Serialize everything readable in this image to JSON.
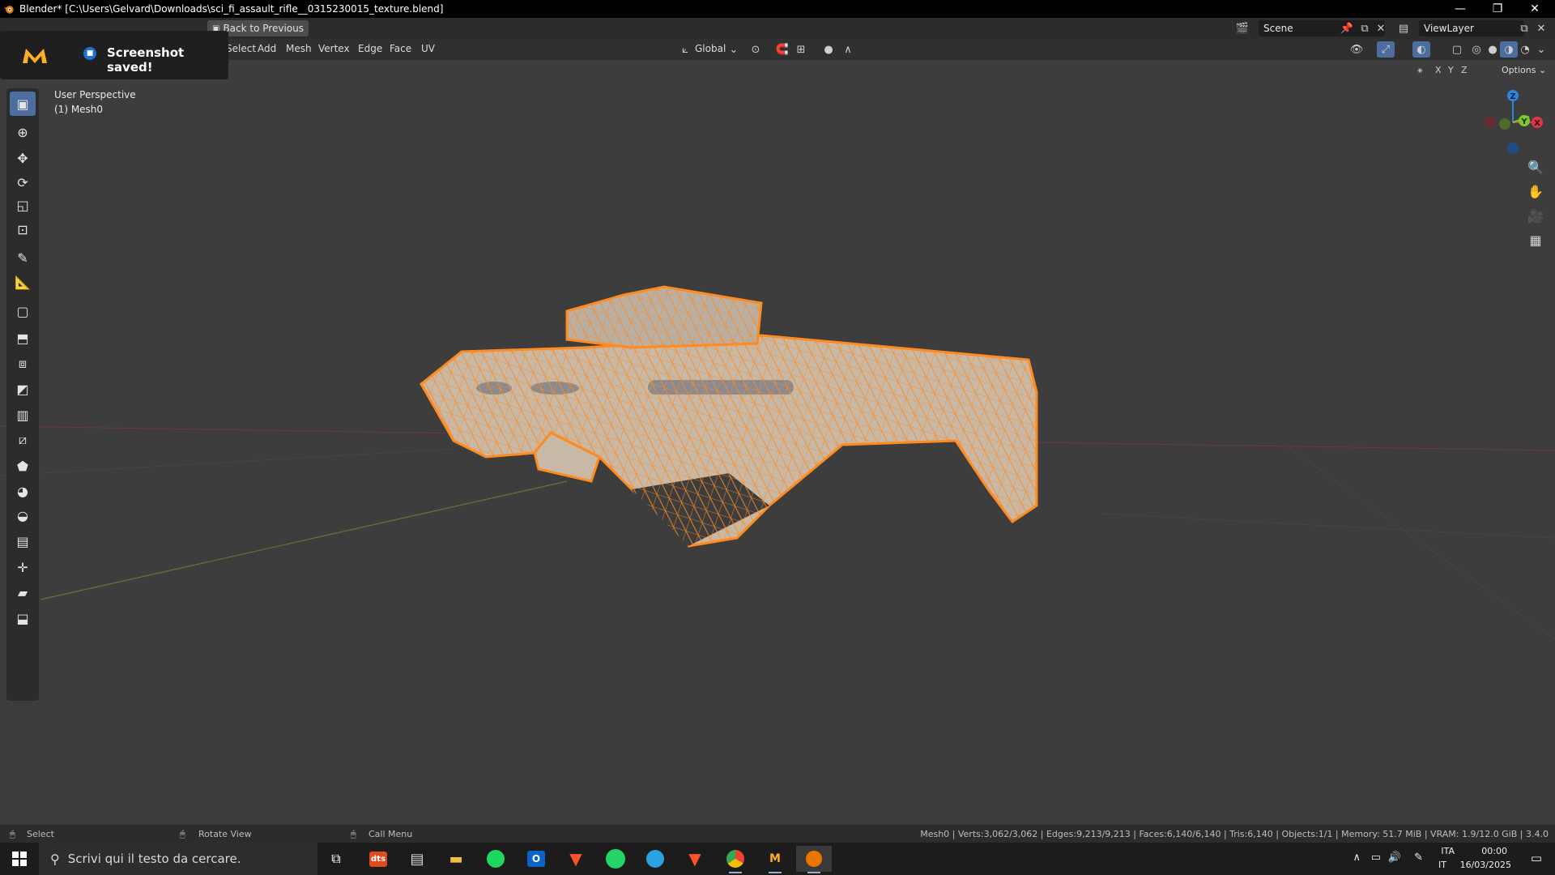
{
  "window": {
    "title": "Blender* [C:\\Users\\Gelvard\\Downloads\\sci_fi_assault_rifle__0315230015_texture.blend]",
    "minimize": "—",
    "restore": "❐",
    "close": "✕"
  },
  "topbar": {
    "back_button": "Back to Previous",
    "scene_label": "Scene",
    "viewlayer_label": "ViewLayer"
  },
  "header": {
    "menus": [
      "Select",
      "Add",
      "Mesh",
      "Vertex",
      "Edge",
      "Face",
      "UV"
    ],
    "transform_orientation": "Global",
    "options_label": "Options",
    "axes": [
      "X",
      "Y",
      "Z"
    ]
  },
  "toast": {
    "message": "Screenshot saved!"
  },
  "viewport": {
    "view_name": "User Perspective",
    "object_name": "(1) Mesh0"
  },
  "gizmo": {
    "z_label": "Z",
    "y_label": "Y",
    "x_label": "X",
    "colors": {
      "x": "#e0364d",
      "y": "#7ec82f",
      "z": "#2f84e0"
    }
  },
  "toolbar": {
    "tools": [
      "select-box-tool",
      "cursor-tool",
      "move-tool",
      "rotate-tool",
      "scale-tool",
      "transform-tool",
      "annotate-tool",
      "measure-tool",
      "add-cube-tool",
      "extrude-tool",
      "inset-tool",
      "bevel-tool",
      "loop-cut-tool",
      "knife-tool",
      "poly-build-tool",
      "spin-tool",
      "smooth-tool",
      "edge-slide-tool",
      "shrink-fatten-tool",
      "shear-tool",
      "rip-tool"
    ]
  },
  "statusbar": {
    "left_action": "Select",
    "middle_action": "Rotate View",
    "right_action": "Call Menu",
    "stats": "Mesh0 | Verts:3,062/3,062 | Edges:9,213/9,213 | Faces:6,140/6,140 | Tris:6,140 | Objects:1/1 | Memory: 51.7 MiB | VRAM: 1.9/12.0 GiB | 3.4.0"
  },
  "taskbar": {
    "search_placeholder": "Scrivi qui il testo da cercare.",
    "lang_top": "ITA",
    "lang_bottom": "IT",
    "time": "00:00",
    "date": "16/03/2025"
  },
  "colors": {
    "accent": "#ff8a1f",
    "active_tool": "#4b6e9f",
    "model": "#c8b8a6"
  }
}
